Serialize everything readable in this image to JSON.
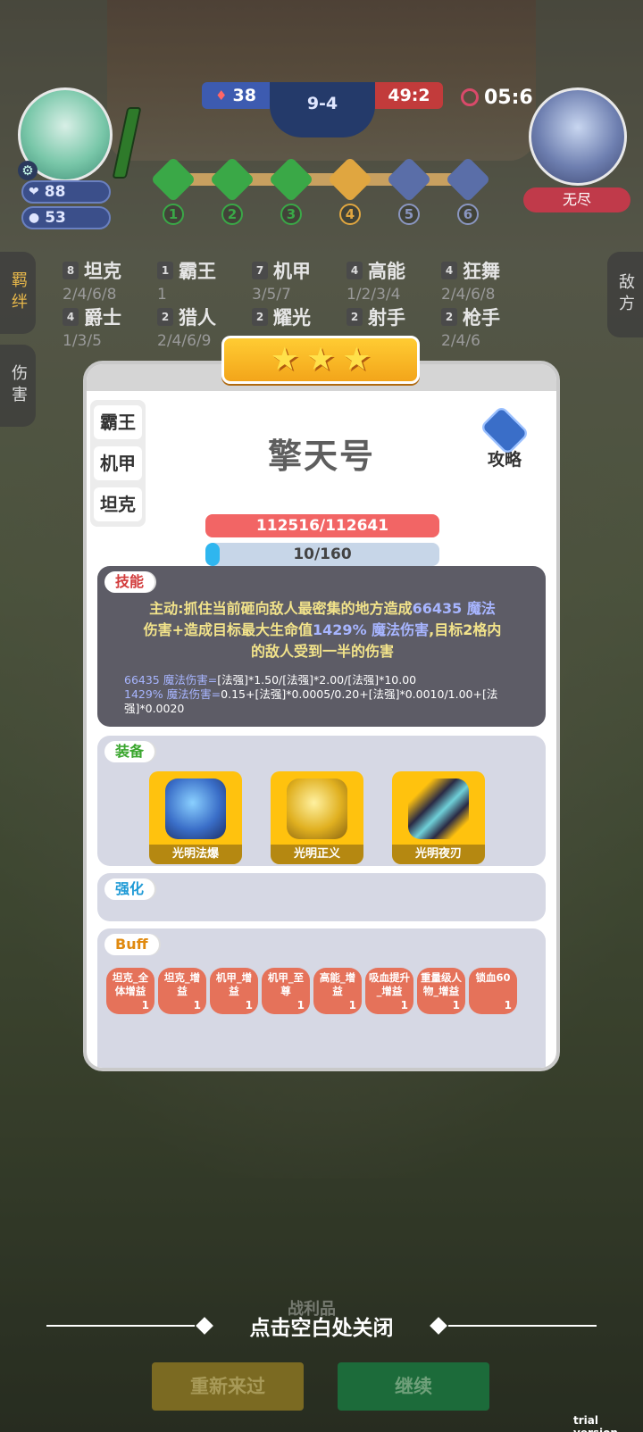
{
  "hud": {
    "player_hp": "88",
    "player_gold": "53",
    "blue_score": "38",
    "round": "9-4",
    "red_score": "49:2",
    "timer": "05:6",
    "enemy_name": "无尽",
    "stages": [
      "1",
      "2",
      "3",
      "4",
      "5",
      "6"
    ]
  },
  "side_tabs": {
    "bonds": "羁绊",
    "damage": "伤害",
    "enemy": "敌方"
  },
  "traits": [
    {
      "count": "8",
      "name": "坦克",
      "levels": "2/4/6/8"
    },
    {
      "count": "1",
      "name": "霸王",
      "levels": "1"
    },
    {
      "count": "7",
      "name": "机甲",
      "levels": "3/5/7"
    },
    {
      "count": "4",
      "name": "高能",
      "levels": "1/2/3/4"
    },
    {
      "count": "4",
      "name": "狂舞",
      "levels": "2/4/6/8"
    },
    {
      "count": "4",
      "name": "爵士",
      "levels": "1/3/5"
    },
    {
      "count": "2",
      "name": "猎人",
      "levels": "2/4/6/9"
    },
    {
      "count": "2",
      "name": "耀光",
      "levels": ""
    },
    {
      "count": "2",
      "name": "射手",
      "levels": ""
    },
    {
      "count": "2",
      "name": "枪手",
      "levels": "2/4/6"
    }
  ],
  "modal": {
    "unit_name": "擎天号",
    "tags": [
      "霸王",
      "机甲",
      "坦克"
    ],
    "guide_label": "攻略",
    "hp_text": "112516/112641",
    "mp_text": "10/160",
    "mp_fraction": 0.0625,
    "star_count": 3,
    "skill": {
      "title": "技能",
      "desc_1": "主动:抓住当前砸向敌人最密集的地方造成",
      "desc_num_1": "66435 魔法",
      "desc_2": "伤害+造成目标最大生命值",
      "desc_num_2": "1429% 魔法伤害",
      "desc_3": ",目标2格内",
      "desc_4": "的敌人受到一半的伤害",
      "formula_1_num": "66435 魔法伤害=",
      "formula_1": "[法强]*1.50/[法强]*2.00/[法强]*10.00",
      "formula_2_num": "1429% 魔法伤害=",
      "formula_2": "0.15+[法强]*0.0005/0.20+[法强]*0.0010/1.00+[法强]*0.0020"
    },
    "equip": {
      "title": "装备",
      "items": [
        "光明法爆",
        "光明正义",
        "光明夜刃"
      ]
    },
    "enhance": {
      "title": "强化"
    },
    "buff": {
      "title": "Buff",
      "chips": [
        {
          "l1": "坦克_全",
          "l2": "体增益",
          "n": "1"
        },
        {
          "l1": "坦克_增",
          "l2": "益",
          "n": "1"
        },
        {
          "l1": "机甲_增",
          "l2": "益",
          "n": "1"
        },
        {
          "l1": "机甲_至",
          "l2": "尊",
          "n": "1"
        },
        {
          "l1": "高能_增",
          "l2": "益",
          "n": "1"
        },
        {
          "l1": "吸血提升",
          "l2": "_增益",
          "n": "1"
        },
        {
          "l1": "重量级人",
          "l2": "物_增益",
          "n": "1"
        },
        {
          "l1": "锁血60",
          "l2": "",
          "n": "1"
        }
      ]
    }
  },
  "bottom": {
    "close_hint": "点击空白处关闭",
    "battle_label": "战利品",
    "retry": "重新来过",
    "continue": "继续",
    "trial": "trial version"
  },
  "colors": {
    "accent_gold": "#ffc20e",
    "hp_red": "#f26565",
    "mp_blue": "#2fb6ef",
    "skill_bg": "#5d5c66",
    "chip_orange": "#e5725a"
  }
}
